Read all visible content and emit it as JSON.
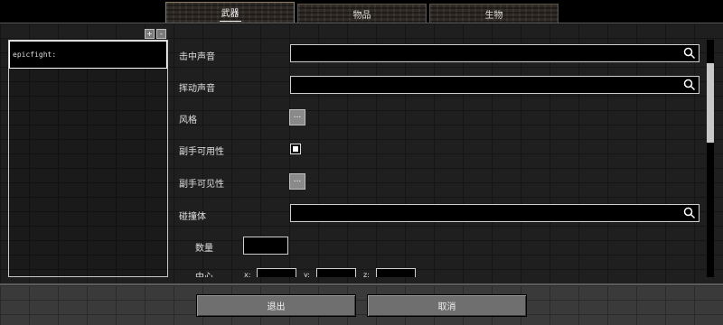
{
  "tabs": [
    {
      "label": "武器",
      "active": true
    },
    {
      "label": "物品",
      "active": false
    },
    {
      "label": "生物",
      "active": false
    }
  ],
  "left_panel": {
    "add_label": "+",
    "remove_label": "-",
    "items": [
      {
        "label": "epicfight:"
      }
    ]
  },
  "form": {
    "hit_sound": {
      "label": "击中声音",
      "value": ""
    },
    "swing_sound": {
      "label": "挥动声音",
      "value": ""
    },
    "style": {
      "label": "风格",
      "button": "..."
    },
    "offhand_usable": {
      "label": "副手可用性",
      "checked": true
    },
    "offhand_visible": {
      "label": "副手可见性",
      "button": "..."
    },
    "collider": {
      "label": "碰撞体",
      "value": ""
    },
    "count": {
      "label": "数量",
      "value": ""
    },
    "center": {
      "label": "中心",
      "x_label": "x:",
      "y_label": "y:",
      "z_label": "z:"
    }
  },
  "footer": {
    "exit_label": "退出",
    "cancel_label": "取消"
  },
  "colors": {
    "background": "#000000",
    "field_border": "#cfcfcf",
    "button": "#6f6f6f"
  }
}
